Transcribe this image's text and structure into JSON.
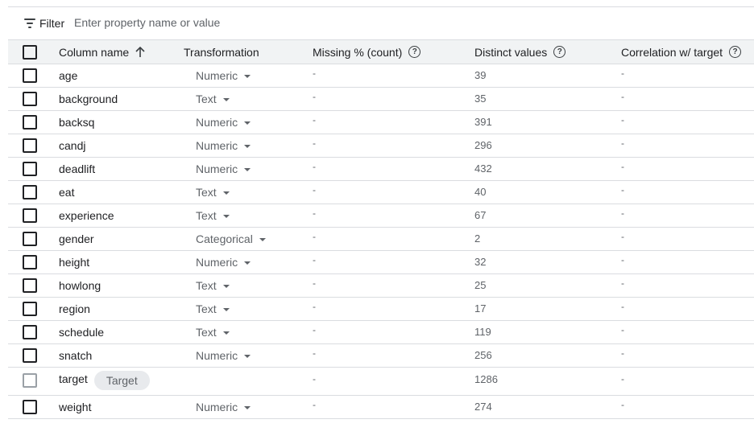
{
  "filter": {
    "label": "Filter",
    "placeholder": "Enter property name or value",
    "value": ""
  },
  "table": {
    "headers": {
      "column_name": "Column name",
      "transformation": "Transformation",
      "missing": "Missing % (count)",
      "distinct": "Distinct values",
      "correlation": "Correlation w/ target"
    },
    "help_glyph": "?",
    "rows": [
      {
        "name": "age",
        "transformation": "Numeric",
        "missing": "-",
        "distinct": "39",
        "correlation": "-"
      },
      {
        "name": "background",
        "transformation": "Text",
        "missing": "-",
        "distinct": "35",
        "correlation": "-"
      },
      {
        "name": "backsq",
        "transformation": "Numeric",
        "missing": "-",
        "distinct": "391",
        "correlation": "-"
      },
      {
        "name": "candj",
        "transformation": "Numeric",
        "missing": "-",
        "distinct": "296",
        "correlation": "-"
      },
      {
        "name": "deadlift",
        "transformation": "Numeric",
        "missing": "-",
        "distinct": "432",
        "correlation": "-"
      },
      {
        "name": "eat",
        "transformation": "Text",
        "missing": "-",
        "distinct": "40",
        "correlation": "-"
      },
      {
        "name": "experience",
        "transformation": "Text",
        "missing": "-",
        "distinct": "67",
        "correlation": "-"
      },
      {
        "name": "gender",
        "transformation": "Categorical",
        "missing": "-",
        "distinct": "2",
        "correlation": "-"
      },
      {
        "name": "height",
        "transformation": "Numeric",
        "missing": "-",
        "distinct": "32",
        "correlation": "-"
      },
      {
        "name": "howlong",
        "transformation": "Text",
        "missing": "-",
        "distinct": "25",
        "correlation": "-"
      },
      {
        "name": "region",
        "transformation": "Text",
        "missing": "-",
        "distinct": "17",
        "correlation": "-"
      },
      {
        "name": "schedule",
        "transformation": "Text",
        "missing": "-",
        "distinct": "119",
        "correlation": "-"
      },
      {
        "name": "snatch",
        "transformation": "Numeric",
        "missing": "-",
        "distinct": "256",
        "correlation": "-"
      },
      {
        "name": "target",
        "target_chip": "Target",
        "transformation": "",
        "missing": "-",
        "distinct": "1286",
        "correlation": "-",
        "is_target": true
      },
      {
        "name": "weight",
        "transformation": "Numeric",
        "missing": "-",
        "distinct": "274",
        "correlation": "-"
      }
    ]
  },
  "icons": {
    "filter": "filter-list-icon",
    "sort": "arrow-upward-icon",
    "help": "help-outline-icon",
    "dropdown": "arrow-drop-down-icon"
  }
}
